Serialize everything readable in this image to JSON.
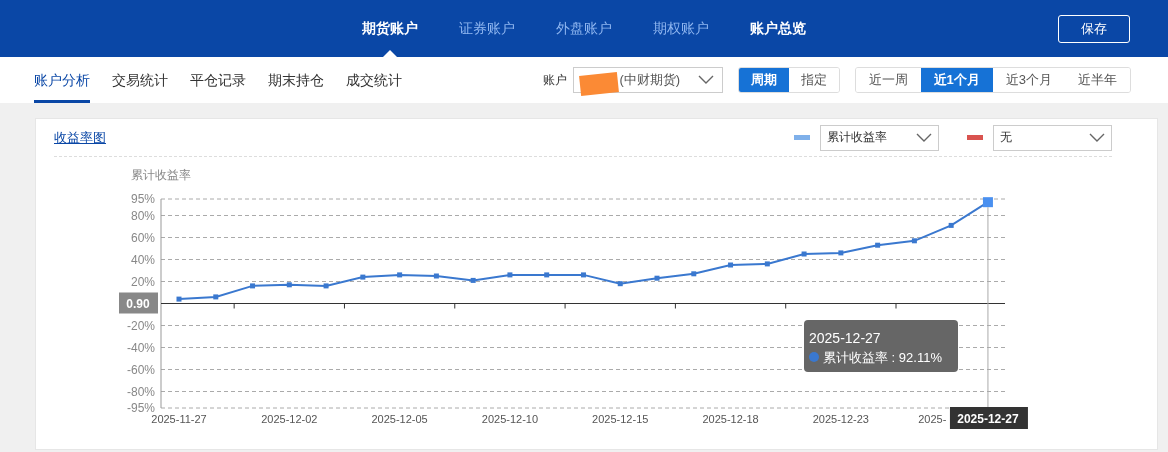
{
  "top_nav": {
    "tabs": [
      {
        "label": "期货账户",
        "selected": true,
        "bright": true
      },
      {
        "label": "证券账户",
        "selected": false,
        "bright": false
      },
      {
        "label": "外盘账户",
        "selected": false,
        "bright": false
      },
      {
        "label": "期权账户",
        "selected": false,
        "bright": false
      },
      {
        "label": "账户总览",
        "selected": false,
        "bright": true
      }
    ],
    "save_button": "保存"
  },
  "sub_nav": {
    "tabs": [
      {
        "label": "账户分析",
        "selected": true
      },
      {
        "label": "交易统计",
        "selected": false
      },
      {
        "label": "平仓记录",
        "selected": false
      },
      {
        "label": "期末持仓",
        "selected": false
      },
      {
        "label": "成交统计",
        "selected": false
      }
    ],
    "account_label": "账户",
    "account_value": "(中财期货)",
    "mode_buttons": [
      {
        "label": "周期",
        "selected": true
      },
      {
        "label": "指定",
        "selected": false
      }
    ],
    "range_buttons": [
      {
        "label": "近一周",
        "selected": false
      },
      {
        "label": "近1个月",
        "selected": true
      },
      {
        "label": "近3个月",
        "selected": false
      },
      {
        "label": "近半年",
        "selected": false
      }
    ]
  },
  "card": {
    "title": "收益率图",
    "legend": [
      {
        "color": "#7fb0ea",
        "value": "累计收益率"
      },
      {
        "color": "#d9534f",
        "value": "无"
      }
    ],
    "chart_data": {
      "type": "line",
      "ylabel": "累计收益率",
      "ylim": [
        -95,
        95
      ],
      "yticks": [
        {
          "value": 95,
          "label": "95%"
        },
        {
          "value": 80,
          "label": "80%"
        },
        {
          "value": 60,
          "label": "60%"
        },
        {
          "value": 40,
          "label": "40%"
        },
        {
          "value": 20,
          "label": "20%"
        },
        {
          "value": -20,
          "label": "-20%"
        },
        {
          "value": -40,
          "label": "-40%"
        },
        {
          "value": -60,
          "label": "-60%"
        },
        {
          "value": -80,
          "label": "-80%"
        },
        {
          "value": -95,
          "label": "-95%"
        }
      ],
      "grid": true,
      "categories": [
        "2025-11-27",
        null,
        null,
        "2025-12-02",
        null,
        null,
        "2025-12-05",
        null,
        null,
        "2025-12-10",
        null,
        null,
        "2025-12-15",
        null,
        null,
        "2025-12-18",
        null,
        null,
        "2025-12-23",
        null,
        null,
        null,
        null
      ],
      "series": [
        {
          "name": "累计收益率",
          "color": "#3a78cf",
          "marker": "square",
          "values": [
            4,
            6,
            16,
            17,
            16,
            24,
            26,
            25,
            21,
            26,
            26,
            26,
            18,
            23,
            27,
            35,
            36,
            45,
            46,
            53,
            57,
            71,
            92.11
          ]
        }
      ]
    },
    "covered_x_label": "2025-",
    "y_pointer_label": "0.90",
    "x_pointer_label": "2025-12-27",
    "tooltip": {
      "date": "2025-12-27",
      "value": ": 92.11%"
    }
  }
}
